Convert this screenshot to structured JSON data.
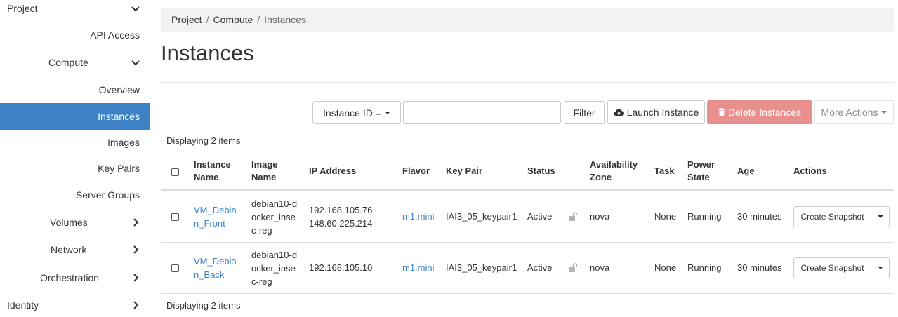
{
  "sidebar": {
    "items": [
      {
        "label": "Project",
        "chevron": "down"
      },
      {
        "label": "API Access"
      },
      {
        "label": "Compute",
        "chevron": "down"
      },
      {
        "label": "Overview"
      },
      {
        "label": "Instances",
        "active": true
      },
      {
        "label": "Images"
      },
      {
        "label": "Key Pairs"
      },
      {
        "label": "Server Groups"
      },
      {
        "label": "Volumes",
        "chevron": "right"
      },
      {
        "label": "Network",
        "chevron": "right"
      },
      {
        "label": "Orchestration",
        "chevron": "right"
      },
      {
        "label": "Identity",
        "chevron": "right"
      }
    ]
  },
  "breadcrumb": {
    "project": "Project",
    "compute": "Compute",
    "current": "Instances",
    "separator": "/"
  },
  "page": {
    "title": "Instances"
  },
  "toolbar": {
    "filter_field": "Instance ID =",
    "filter_value": "",
    "filter_button": "Filter",
    "launch_button": "Launch Instance",
    "delete_button": "Delete Instances",
    "more_button": "More Actions"
  },
  "table": {
    "count_top": "Displaying 2 items",
    "count_bottom": "Displaying 2 items",
    "headers": {
      "name_1": "Instance",
      "name_2": "Name",
      "image_1": "Image",
      "image_2": "Name",
      "ip": "IP Address",
      "flavor": "Flavor",
      "keypair": "Key Pair",
      "status": "Status",
      "az_1": "Availability",
      "az_2": "Zone",
      "task": "Task",
      "power_1": "Power",
      "power_2": "State",
      "age": "Age",
      "actions": "Actions"
    },
    "rows": [
      {
        "name_1": "VM_Debia",
        "name_2": "n_Front",
        "image_1": "debian10-d",
        "image_2": "ocker_inse",
        "image_3": "c-reg",
        "ip_1": "192.168.105.76,",
        "ip_2": "148.60.225.214",
        "flavor": "m1.mini",
        "keypair": "IAI3_05_keypair1",
        "status": "Active",
        "az": "nova",
        "task": "None",
        "power": "Running",
        "age": "30 minutes",
        "action": "Create Snapshot"
      },
      {
        "name_1": "VM_Debia",
        "name_2": "n_Back",
        "image_1": "debian10-d",
        "image_2": "ocker_inse",
        "image_3": "c-reg",
        "ip_1": "192.168.105.10",
        "ip_2": "",
        "flavor": "m1.mini",
        "keypair": "IAI3_05_keypair1",
        "status": "Active",
        "az": "nova",
        "task": "None",
        "power": "Running",
        "age": "30 minutes",
        "action": "Create Snapshot"
      }
    ]
  },
  "colors": {
    "accent": "#3d82c4",
    "danger": "#e8908e",
    "breadcrumb_bg": "#f2f2f2"
  }
}
